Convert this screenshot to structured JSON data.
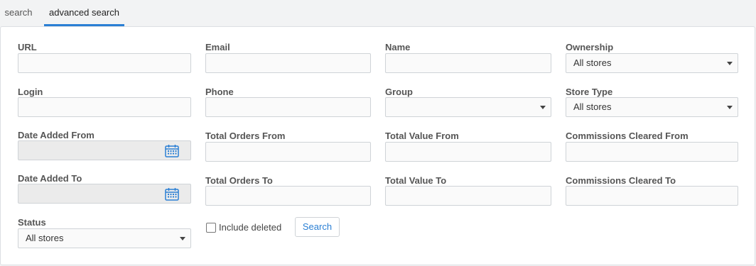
{
  "tabs": [
    {
      "label": "search"
    },
    {
      "label": "advanced search"
    }
  ],
  "fields": {
    "url": {
      "label": "URL",
      "value": ""
    },
    "email": {
      "label": "Email",
      "value": ""
    },
    "name": {
      "label": "Name",
      "value": ""
    },
    "ownership": {
      "label": "Ownership",
      "selected": "All stores"
    },
    "login": {
      "label": "Login",
      "value": ""
    },
    "phone": {
      "label": "Phone",
      "value": ""
    },
    "group": {
      "label": "Group",
      "selected": ""
    },
    "store_type": {
      "label": "Store Type",
      "selected": "All stores"
    },
    "date_added_from": {
      "label": "Date Added From",
      "value": ""
    },
    "total_orders_from": {
      "label": "Total Orders From",
      "value": ""
    },
    "total_value_from": {
      "label": "Total Value From",
      "value": ""
    },
    "commissions_cleared_from": {
      "label": "Commissions Cleared From",
      "value": ""
    },
    "date_added_to": {
      "label": "Date Added To",
      "value": ""
    },
    "total_orders_to": {
      "label": "Total Orders To",
      "value": ""
    },
    "total_value_to": {
      "label": "Total Value To",
      "value": ""
    },
    "commissions_cleared_to": {
      "label": "Commissions Cleared To",
      "value": ""
    },
    "status": {
      "label": "Status",
      "selected": "All stores"
    }
  },
  "include_deleted": {
    "label": "Include deleted",
    "checked": false
  },
  "search_button": {
    "label": "Search"
  },
  "colors": {
    "accent": "#2a7fd4",
    "calendar_icon": "#2a7fd4"
  },
  "icons": {
    "calendar": "calendar-icon",
    "dropdown": "chevron-down-icon"
  }
}
